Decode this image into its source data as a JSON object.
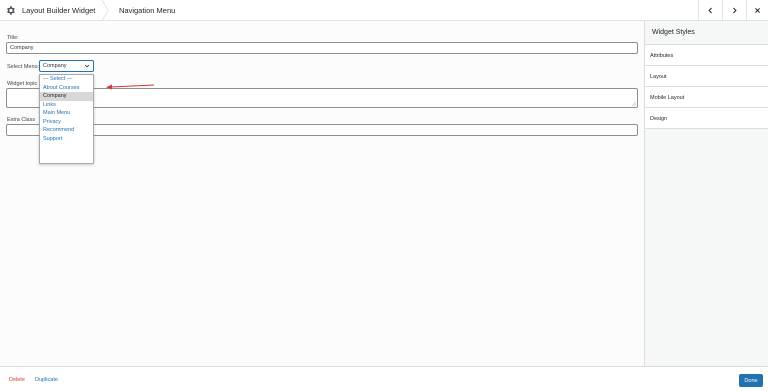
{
  "header": {
    "app_title": "Layout Builder Widget",
    "page_title": "Navigation Menu"
  },
  "form": {
    "title_label": "Title:",
    "title_value": "Company",
    "select_menu_label": "Select Menu:",
    "select_menu_value": "Company",
    "widget_topic_label": "Widget topic",
    "extra_class_label": "Extra Class",
    "menu_options": [
      "— Select —",
      "About Courses",
      "Company",
      "Links",
      "Main Menu",
      "Privacy",
      "Recommend",
      "Support"
    ],
    "selected_option": "Company",
    "annotation_color": "#d63638"
  },
  "sidebar": {
    "title": "Widget Styles",
    "items": [
      "Attributes",
      "Layout",
      "Mobile Layout",
      "Design"
    ]
  },
  "footer": {
    "delete_label": "Delete",
    "duplicate_label": "Duplicate",
    "done_label": "Done"
  },
  "colors": {
    "accent": "#2271b1",
    "danger": "#d63638"
  },
  "icons": [
    "gear-icon",
    "chevron-left-icon",
    "chevron-right-icon",
    "close-icon",
    "chevron-down-icon",
    "resize-grip-icon"
  ]
}
